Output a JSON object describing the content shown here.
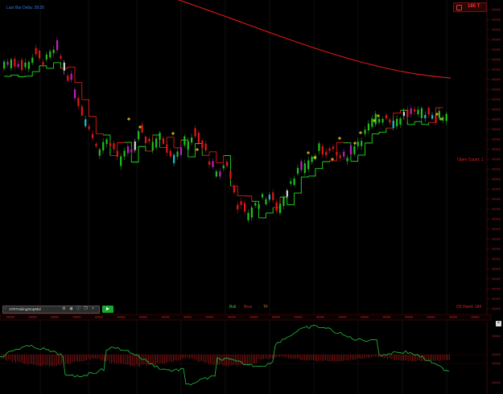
{
  "window": {
    "last_bar_delta": "Last Bar Delta: 28:35",
    "position_badge": {
      "value": "185",
      "suffix": "T"
    },
    "open_count": "Open Count: 1",
    "o2_hand": "O2 Hand: 184"
  },
  "legend": {
    "bull": "Bull",
    "bear": "Bear",
    "third": "TF",
    "separator": "·"
  },
  "indicator_bar": {
    "name": "ATRTrailingStopMid",
    "icons": [
      "gear-icon",
      "eye-icon",
      "info-icon",
      "copy-icon",
      "close-icon"
    ]
  },
  "colors": {
    "background": "#000000",
    "bull": "#20c020",
    "bear": "#e01818",
    "magenta": "#c020c0",
    "cyan": "#20c0d0",
    "trail": "#20e020",
    "ma": "#e01818",
    "signal": "#f0e020",
    "oscillator": "#20c040",
    "histogram": "#b01818"
  },
  "chart_data": {
    "type": "candlestick",
    "price_series": [
      {
        "time": 1,
        "close": 100.0
      },
      {
        "time": 2,
        "close": 100.6
      },
      {
        "time": 3,
        "close": 99.8
      },
      {
        "time": 4,
        "close": 101.2
      },
      {
        "time": 5,
        "close": 100.4
      },
      {
        "time": 6,
        "close": 101.8
      },
      {
        "time": 7,
        "close": 99.0
      },
      {
        "time": 8,
        "close": 96.0
      },
      {
        "time": 9,
        "close": 92.5
      },
      {
        "time": 10,
        "close": 90.0
      },
      {
        "time": 11,
        "close": 91.0
      },
      {
        "time": 12,
        "close": 88.5
      },
      {
        "time": 13,
        "close": 89.8
      },
      {
        "time": 14,
        "close": 91.8
      },
      {
        "time": 15,
        "close": 90.6
      },
      {
        "time": 16,
        "close": 91.2
      },
      {
        "time": 17,
        "close": 89.2
      },
      {
        "time": 18,
        "close": 90.4
      },
      {
        "time": 19,
        "close": 91.6
      },
      {
        "time": 20,
        "close": 89.9
      },
      {
        "time": 21,
        "close": 86.5
      },
      {
        "time": 22,
        "close": 88.4
      },
      {
        "time": 23,
        "close": 83.5
      },
      {
        "time": 24,
        "close": 82.1
      },
      {
        "time": 25,
        "close": 83.6
      },
      {
        "time": 26,
        "close": 84.3
      },
      {
        "time": 27,
        "close": 82.9
      },
      {
        "time": 28,
        "close": 86.2
      },
      {
        "time": 29,
        "close": 87.4
      },
      {
        "time": 30,
        "close": 88.6
      },
      {
        "time": 31,
        "close": 90.1
      },
      {
        "time": 32,
        "close": 89.5
      },
      {
        "time": 33,
        "close": 88.8
      },
      {
        "time": 34,
        "close": 90.2
      },
      {
        "time": 35,
        "close": 91.7
      },
      {
        "time": 36,
        "close": 93.2
      },
      {
        "time": 37,
        "close": 94.0
      },
      {
        "time": 38,
        "close": 93.1
      },
      {
        "time": 39,
        "close": 94.4
      },
      {
        "time": 40,
        "close": 93.8
      },
      {
        "time": 41,
        "close": 94.5
      },
      {
        "time": 42,
        "close": 93.6
      },
      {
        "time": 43,
        "close": 94.2
      }
    ],
    "moving_average_start": 108.5,
    "moving_average_end": 94.8
  }
}
